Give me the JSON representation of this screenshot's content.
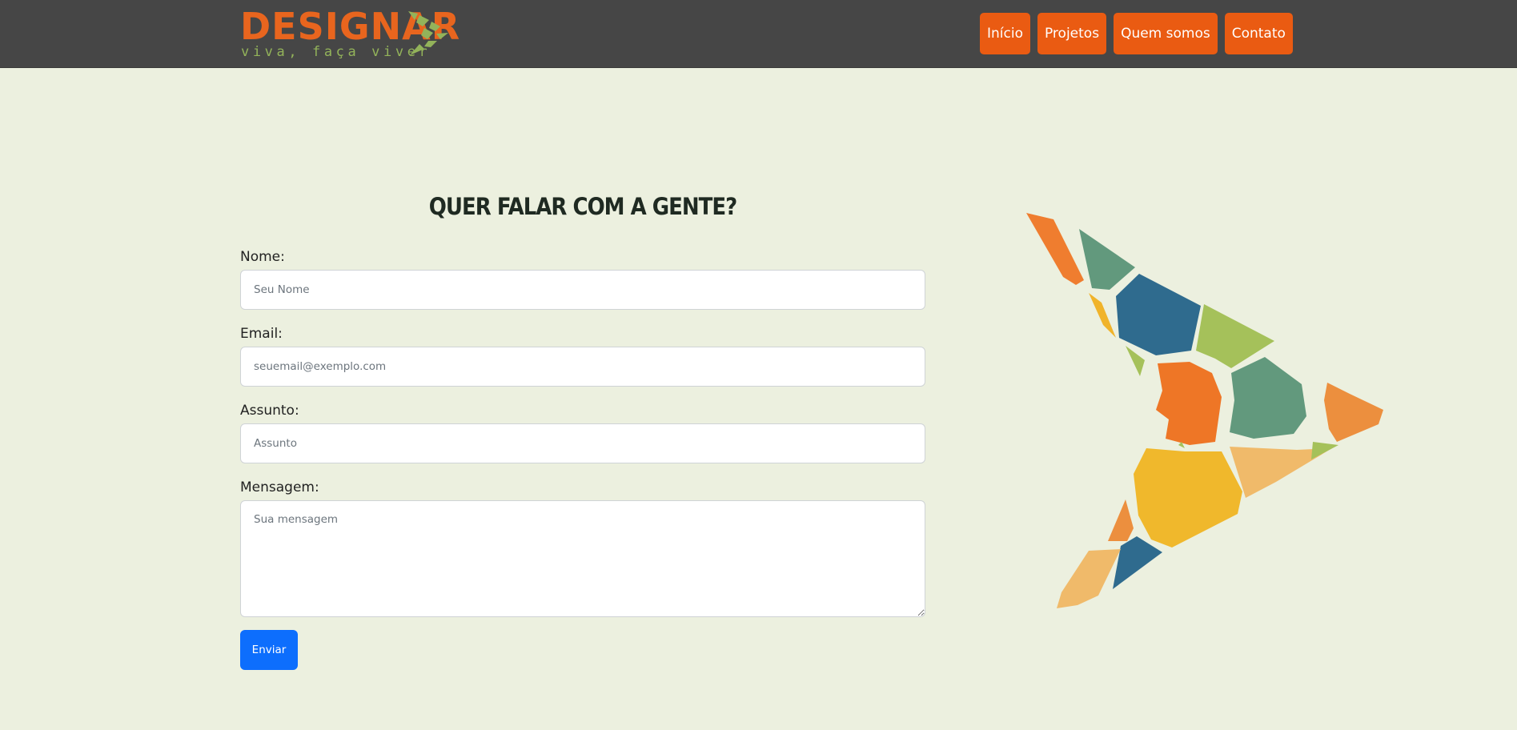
{
  "header": {
    "logo": {
      "name": "DESIGNAR",
      "tagline": "viva, faça viver"
    },
    "nav": [
      {
        "label": "Início"
      },
      {
        "label": "Projetos"
      },
      {
        "label": "Quem somos"
      },
      {
        "label": "Contato"
      }
    ]
  },
  "form": {
    "title": "QUER FALAR COM A GENTE?",
    "name_label": "Nome:",
    "name_placeholder": "Seu Nome",
    "email_label": "Email:",
    "email_placeholder": "seuemail@exemplo.com",
    "subject_label": "Assunto:",
    "subject_placeholder": "Assunto",
    "message_label": "Mensagem:",
    "message_placeholder": "Sua mensagem",
    "submit_label": "Enviar"
  },
  "colors": {
    "navbar_bg": "#464646",
    "accent_orange": "#ea5b12",
    "page_bg": "#ecf0df",
    "submit_blue": "#0d6efd",
    "logo_green": "#93b35a"
  },
  "icons": {
    "logo_mark": "mosaic-arrow-icon",
    "decoration": "mosaic-arrow-illustration"
  }
}
